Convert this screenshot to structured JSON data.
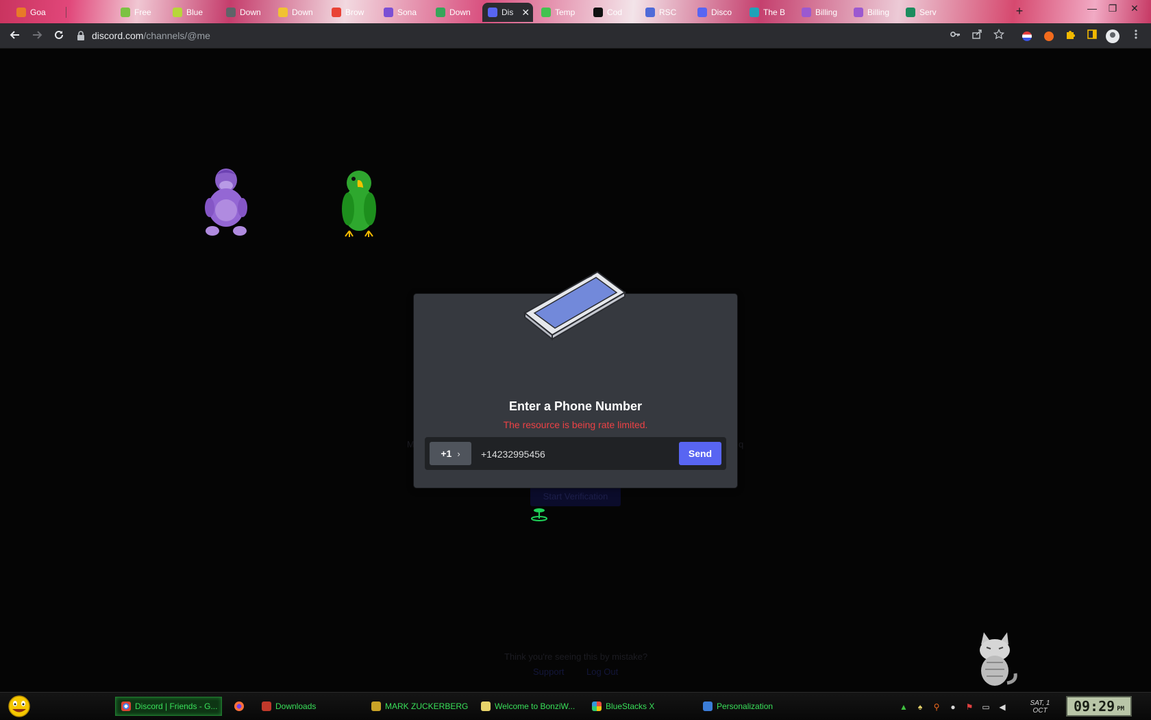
{
  "browser": {
    "tabs": [
      {
        "label": "Goa",
        "favicon_color": "#e87a28"
      },
      {
        "label": "Free",
        "favicon_color": "#7cc242"
      },
      {
        "label": "Blue",
        "favicon_color": "#b7d63a"
      },
      {
        "label": "Down",
        "favicon_color": "#5f6368"
      },
      {
        "label": "Down",
        "favicon_color": "#f1c232"
      },
      {
        "label": "Brow",
        "favicon_color": "#e94235"
      },
      {
        "label": "Sona",
        "favicon_color": "#7b4fd4"
      },
      {
        "label": "Down",
        "favicon_color": "#37a55a"
      },
      {
        "label": "Dis",
        "favicon_color": "#5865f2",
        "active": true
      },
      {
        "label": "Temp",
        "favicon_color": "#42c24f"
      },
      {
        "label": "Cod",
        "favicon_color": "#111111"
      },
      {
        "label": "RSC",
        "favicon_color": "#4f6bd8"
      },
      {
        "label": "Disco",
        "favicon_color": "#5865f2"
      },
      {
        "label": "The B",
        "favicon_color": "#1fa3b8"
      },
      {
        "label": "Billing",
        "favicon_color": "#9b59d0"
      },
      {
        "label": "Billing",
        "favicon_color": "#9b59d0"
      },
      {
        "label": "Serv",
        "favicon_color": "#1c8c5e"
      }
    ],
    "active_tab_close": "✕",
    "new_tab": "+",
    "window_controls": {
      "minimize": "—",
      "restore": "❐",
      "close": "✕"
    },
    "url": {
      "host": "discord.com",
      "path": "/channels/@me"
    },
    "icons": {
      "back": "back-arrow-icon",
      "forward": "forward-arrow-icon",
      "reload": "reload-icon",
      "lock": "lock-icon",
      "key": "key-icon",
      "share": "share-icon",
      "star": "star-icon",
      "extensions": "puzzle-icon",
      "sidebar": "side-panel-icon",
      "menu": "kebab-menu-icon"
    }
  },
  "background": {
    "faint_side_left": "M",
    "faint_side_right": "q",
    "faint_button": "Start Verification",
    "faint_question": "Think you're seeing this by mistake?",
    "faint_link_support": "Support",
    "faint_link_logout": "Log Out"
  },
  "modal": {
    "title": "Enter a Phone Number",
    "error": "The resource is being rate limited.",
    "country_code": "+1",
    "phone_value": "+14232995456",
    "send_label": "Send",
    "colors": {
      "error": "#ed4245",
      "send": "#5865f2",
      "modal_bg": "#36393f"
    }
  },
  "taskbar": {
    "items": [
      {
        "label": "Discord | Friends - G...",
        "icon_color": "#db4437",
        "active": true
      },
      {
        "label": "",
        "icon_color": "#ff7139"
      },
      {
        "label": "Downloads",
        "icon_color": "#c0392b"
      },
      {
        "label": "MARK ZUCKERBERG",
        "icon_color": "#c9a227"
      },
      {
        "label": "Welcome to BonziW...",
        "icon_color": "#e7d36a"
      },
      {
        "label": "BlueStacks X",
        "icon_color": "#e84c3d"
      },
      {
        "label": "Personalization",
        "icon_color": "#3b7dd8"
      }
    ],
    "date_day": "SAT, 1",
    "date_month": "OCT",
    "clock_time": "09:29",
    "clock_ampm": "PM"
  }
}
